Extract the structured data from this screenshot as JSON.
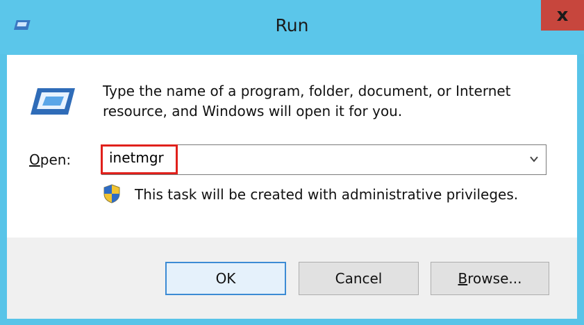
{
  "window": {
    "title": "Run",
    "close_label": "x"
  },
  "dialog": {
    "description_line1": "Type the name of a program, folder, document, or Internet",
    "description_line2": "resource, and Windows will open it for you.",
    "open_label_mnemonic": "O",
    "open_label_rest": "pen:",
    "command_value": "inetmgr",
    "admin_notice": "This task will be created with administrative privileges."
  },
  "buttons": {
    "ok": "OK",
    "cancel": "Cancel",
    "browse_mnemonic": "B",
    "browse_rest": "rowse..."
  },
  "colors": {
    "titlebar": "#5bc6ea",
    "close_button": "#c7463d",
    "highlight_box": "#e0201b",
    "footer": "#f0f0f0"
  },
  "icons": [
    "run-icon",
    "run-icon-large",
    "close-icon",
    "chevron-down-icon",
    "uac-shield-icon"
  ]
}
